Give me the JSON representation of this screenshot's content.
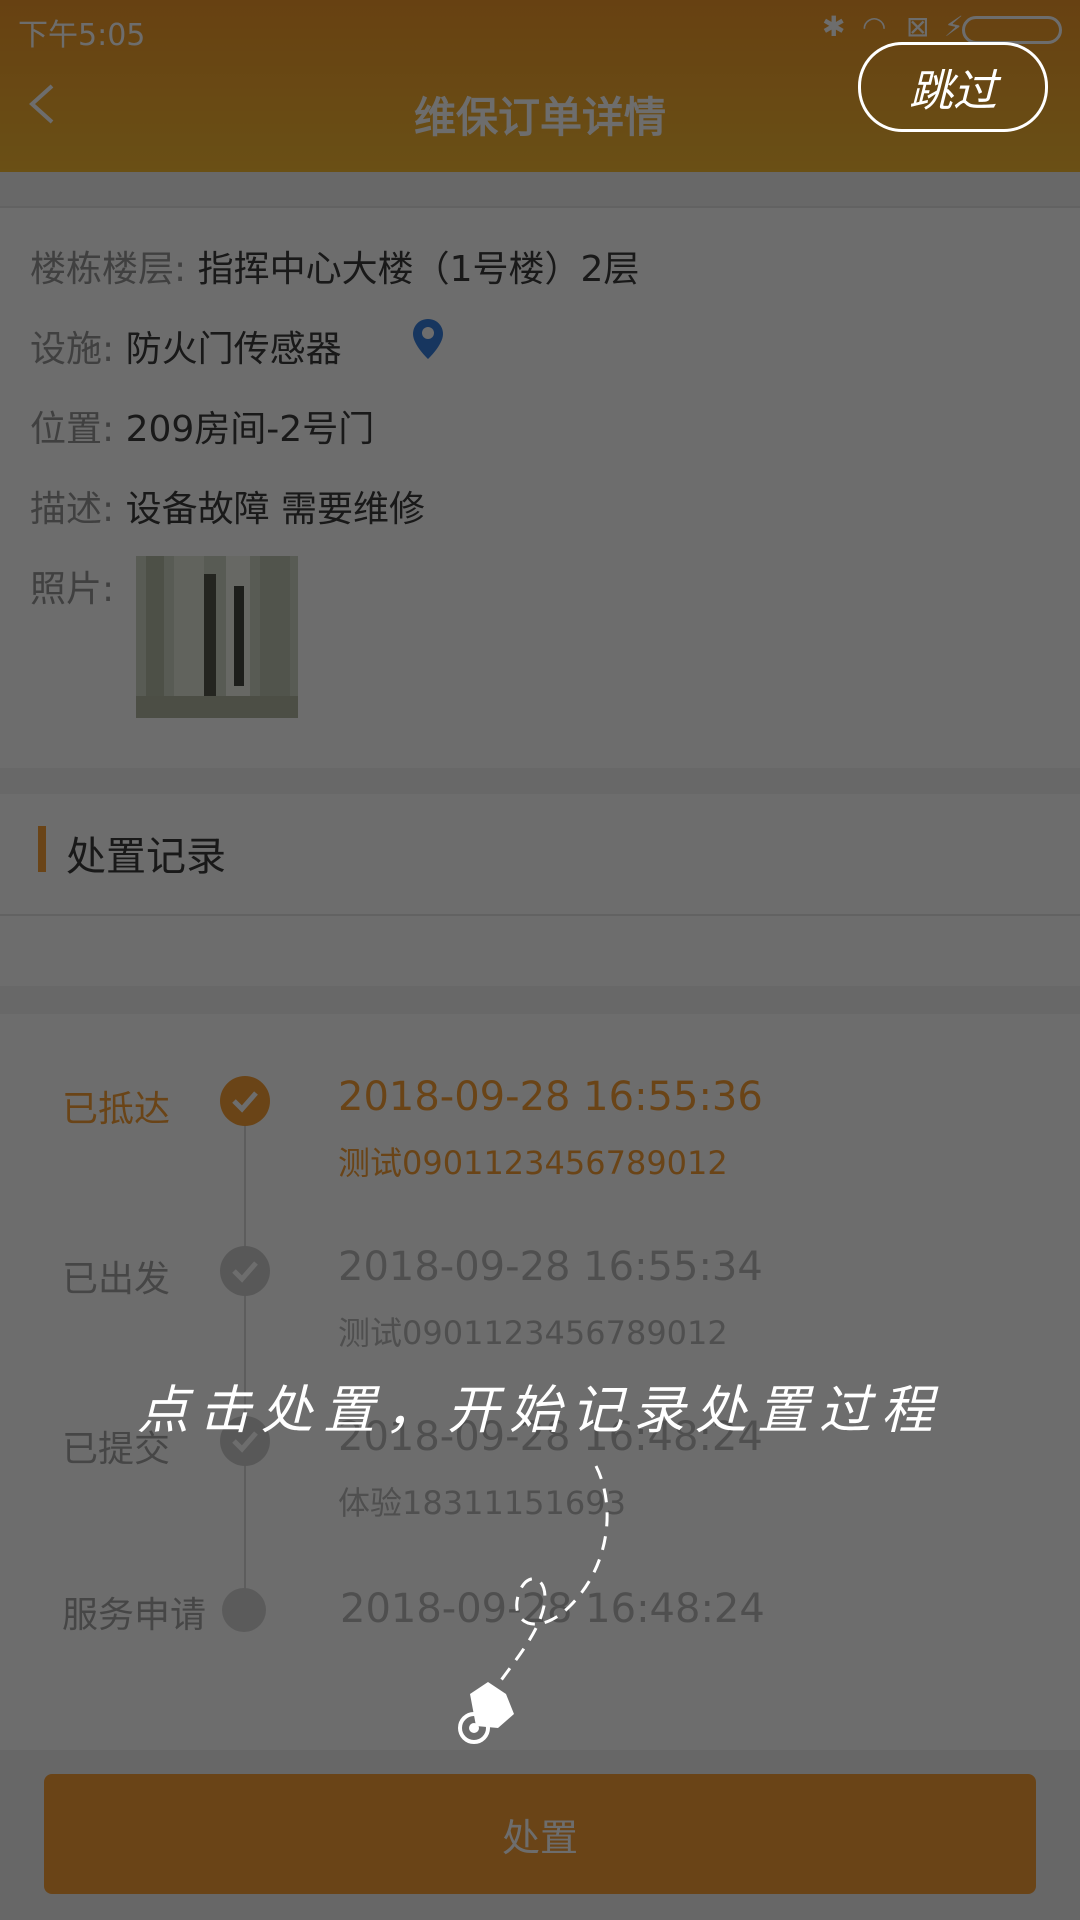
{
  "status_bar": {
    "time": "下午5:05",
    "icons": [
      "bluetooth-icon",
      "wifi-icon",
      "sim-icon",
      "charging-icon",
      "battery-icon"
    ]
  },
  "header": {
    "title": "维保订单详情",
    "back_icon": "chevron-left-icon"
  },
  "detail": {
    "building": {
      "label": "楼栋楼层:",
      "value": "指挥中心大楼（1号楼）2层"
    },
    "facility": {
      "label": "设施:",
      "value": "防火门传感器",
      "icon": "location-pin-icon"
    },
    "location": {
      "label": "位置:",
      "value": "209房间-2号门"
    },
    "description": {
      "label": "描述:",
      "value": "设备故障 需要维修"
    },
    "photo": {
      "label": "照片:"
    }
  },
  "section": {
    "title": "处置记录"
  },
  "timeline": [
    {
      "status": "已抵达",
      "time": "2018-09-28 16:55:36",
      "user": "测试0901123456789012",
      "active": true
    },
    {
      "status": "已出发",
      "time": "2018-09-28 16:55:34",
      "user": "测试0901123456789012",
      "active": false
    },
    {
      "status": "已提交",
      "time": "2018-09-28 16:48:24",
      "user": "体验18311151693",
      "active": false
    },
    {
      "status": "服务申请",
      "time": "2018-09-28 16:48:24",
      "user": "",
      "active": false
    }
  ],
  "action": {
    "label": "处置"
  },
  "guide": {
    "skip_label": "跳过",
    "hint": "点击处置，开始记录处置过程"
  },
  "colors": {
    "accent": "#f7931e",
    "header": "#f6a817",
    "pin": "#1e6fd9"
  }
}
